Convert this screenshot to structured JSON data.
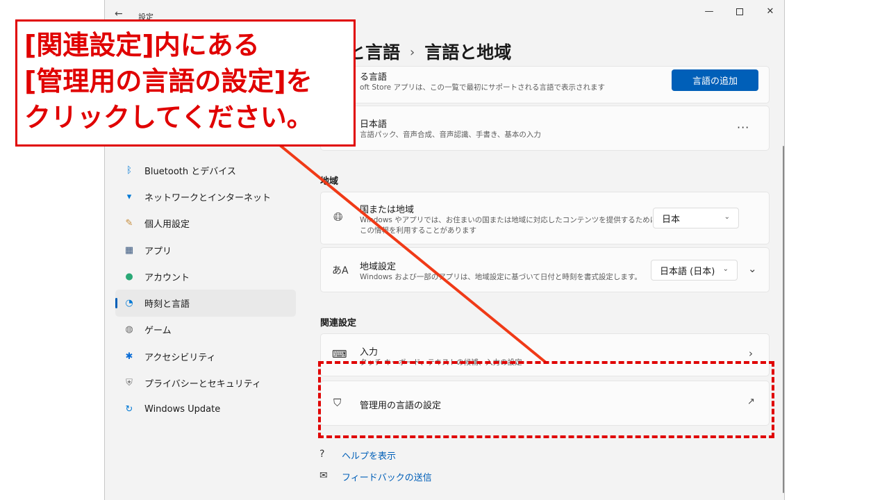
{
  "window": {
    "title": "設定",
    "back_glyph": "←",
    "min_glyph": "—",
    "close_glyph": "✕"
  },
  "breadcrumb": {
    "parent": "と言語",
    "separator": "›",
    "current": "言語と地域"
  },
  "nav": {
    "items": [
      {
        "label": "Bluetooth とデバイス",
        "icon": "bluetooth-icon",
        "glyph": "ᛒ",
        "color": "#0078d4"
      },
      {
        "label": "ネットワークとインターネット",
        "icon": "wifi-icon",
        "glyph": "▾",
        "color": "#0078d4"
      },
      {
        "label": "個人用設定",
        "icon": "brush-icon",
        "glyph": "✎",
        "color": "#c58b3a"
      },
      {
        "label": "アプリ",
        "icon": "apps-icon",
        "glyph": "▦",
        "color": "#3d5a80"
      },
      {
        "label": "アカウント",
        "icon": "account-icon",
        "glyph": "●",
        "color": "#2aa876"
      },
      {
        "label": "時刻と言語",
        "icon": "clock-globe-icon",
        "glyph": "◔",
        "color": "#0078d4"
      },
      {
        "label": "ゲーム",
        "icon": "gamepad-icon",
        "glyph": "◍",
        "color": "#6b6b6b"
      },
      {
        "label": "アクセシビリティ",
        "icon": "accessibility-icon",
        "glyph": "✱",
        "color": "#0a6cd6"
      },
      {
        "label": "プライバシーとセキュリティ",
        "icon": "shield-icon",
        "glyph": "⛨",
        "color": "#7a7a7a"
      },
      {
        "label": "Windows Update",
        "icon": "update-icon",
        "glyph": "↻",
        "color": "#0078d4"
      }
    ]
  },
  "language": {
    "pref_title": "る言語",
    "pref_sub": "oft Store アプリは、この一覧で最初にサポートされる言語で表示されます",
    "add_button": "言語の追加",
    "japanese_title": "日本語",
    "japanese_sub": "言語パック、音声合成、音声認識、手書き、基本の入力",
    "more_glyph": "···"
  },
  "region": {
    "heading": "地域",
    "country_title": "国または地域",
    "country_sub1": "Windows やアプリでは、お住まいの国または地域に対応したコンテンツを提供するために、",
    "country_sub2": "この情報を利用することがあります",
    "country_value": "日本",
    "format_title": "地域設定",
    "format_sub": "Windows および一部のアプリは、地域設定に基づいて日付と時刻を書式設定します。",
    "format_value": "日本語 (日本)",
    "chevron_glyph": "⌄",
    "expand_glyph": "⌄"
  },
  "related": {
    "heading": "関連設定",
    "input_title": "入力",
    "input_sub": "タッチ キーボード、テキストの候補、入力の設定",
    "input_arrow": "›",
    "admin_title": "管理用の言語の設定",
    "admin_ext_glyph": "↗"
  },
  "footer": {
    "help": "ヘルプを表示",
    "feedback": "フィードバックの送信"
  },
  "callout": {
    "line1": "[関連設定]内にある",
    "line2": "[管理用の言語の設定]を",
    "line3": "クリックしてください。",
    "color": "#e00000"
  }
}
